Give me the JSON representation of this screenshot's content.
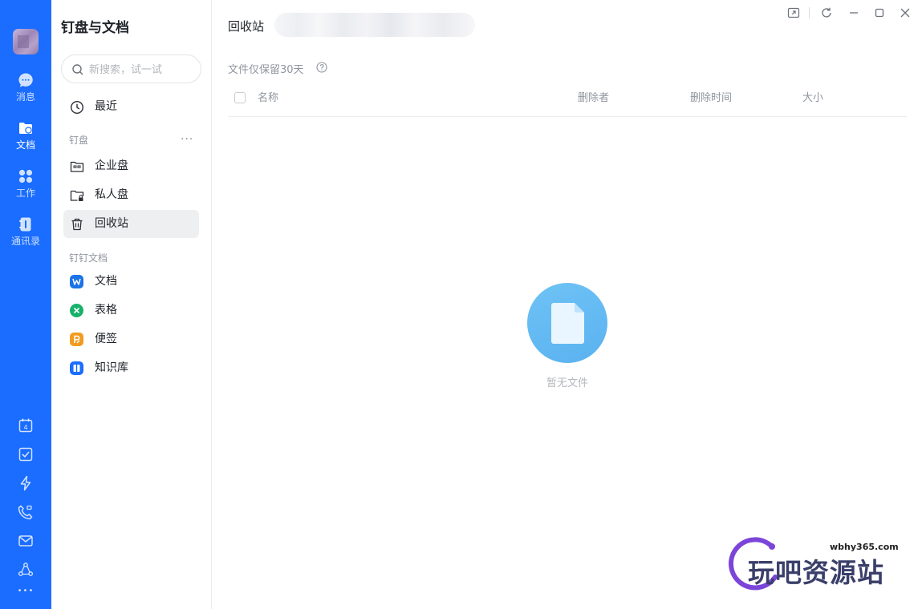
{
  "rail": {
    "items": [
      {
        "label": "消息",
        "icon": "chat-icon"
      },
      {
        "label": "文档",
        "icon": "folder-icon",
        "active": true
      },
      {
        "label": "工作",
        "icon": "apps-icon"
      },
      {
        "label": "通讯录",
        "icon": "contacts-icon"
      }
    ],
    "bottom_icons": [
      "calendar-icon",
      "todo-icon",
      "flash-icon",
      "video-call-icon",
      "mail-icon",
      "network-icon",
      "more-icon"
    ],
    "calendar_day": "4",
    "more_glyph": "•••"
  },
  "nav": {
    "title": "钉盘与文档",
    "search_placeholder": "新搜索，试一试",
    "recent_label": "最近",
    "section_drive": "钉盘",
    "section_more": "···",
    "drive_items": [
      {
        "label": "企业盘",
        "icon": "enterprise-drive-icon"
      },
      {
        "label": "私人盘",
        "icon": "private-drive-icon"
      },
      {
        "label": "回收站",
        "icon": "trash-icon",
        "selected": true
      }
    ],
    "section_docs": "钉钉文档",
    "doc_items": [
      {
        "label": "文档",
        "icon": "doc-icon",
        "color": "#1a73e8",
        "glyph": "W"
      },
      {
        "label": "表格",
        "icon": "sheet-icon",
        "color": "#17b26a",
        "glyph": "✕"
      },
      {
        "label": "便签",
        "icon": "note-icon",
        "color": "#f29b1f",
        "glyph": "P"
      },
      {
        "label": "知识库",
        "icon": "knowledge-base-icon",
        "color": "#1a6dff",
        "glyph": "▮"
      }
    ]
  },
  "main": {
    "crumb": "回收站",
    "hint": "文件仅保留30天",
    "columns": [
      "名称",
      "删除者",
      "删除时间",
      "大小"
    ],
    "empty_text": "暂无文件"
  },
  "watermark": {
    "url": "wbhy365.com",
    "text": "玩吧资源站"
  },
  "colors": {
    "rail": "#1a6dff",
    "selected_bg": "#eeeff0",
    "empty_circle": "#5ab2f0"
  }
}
